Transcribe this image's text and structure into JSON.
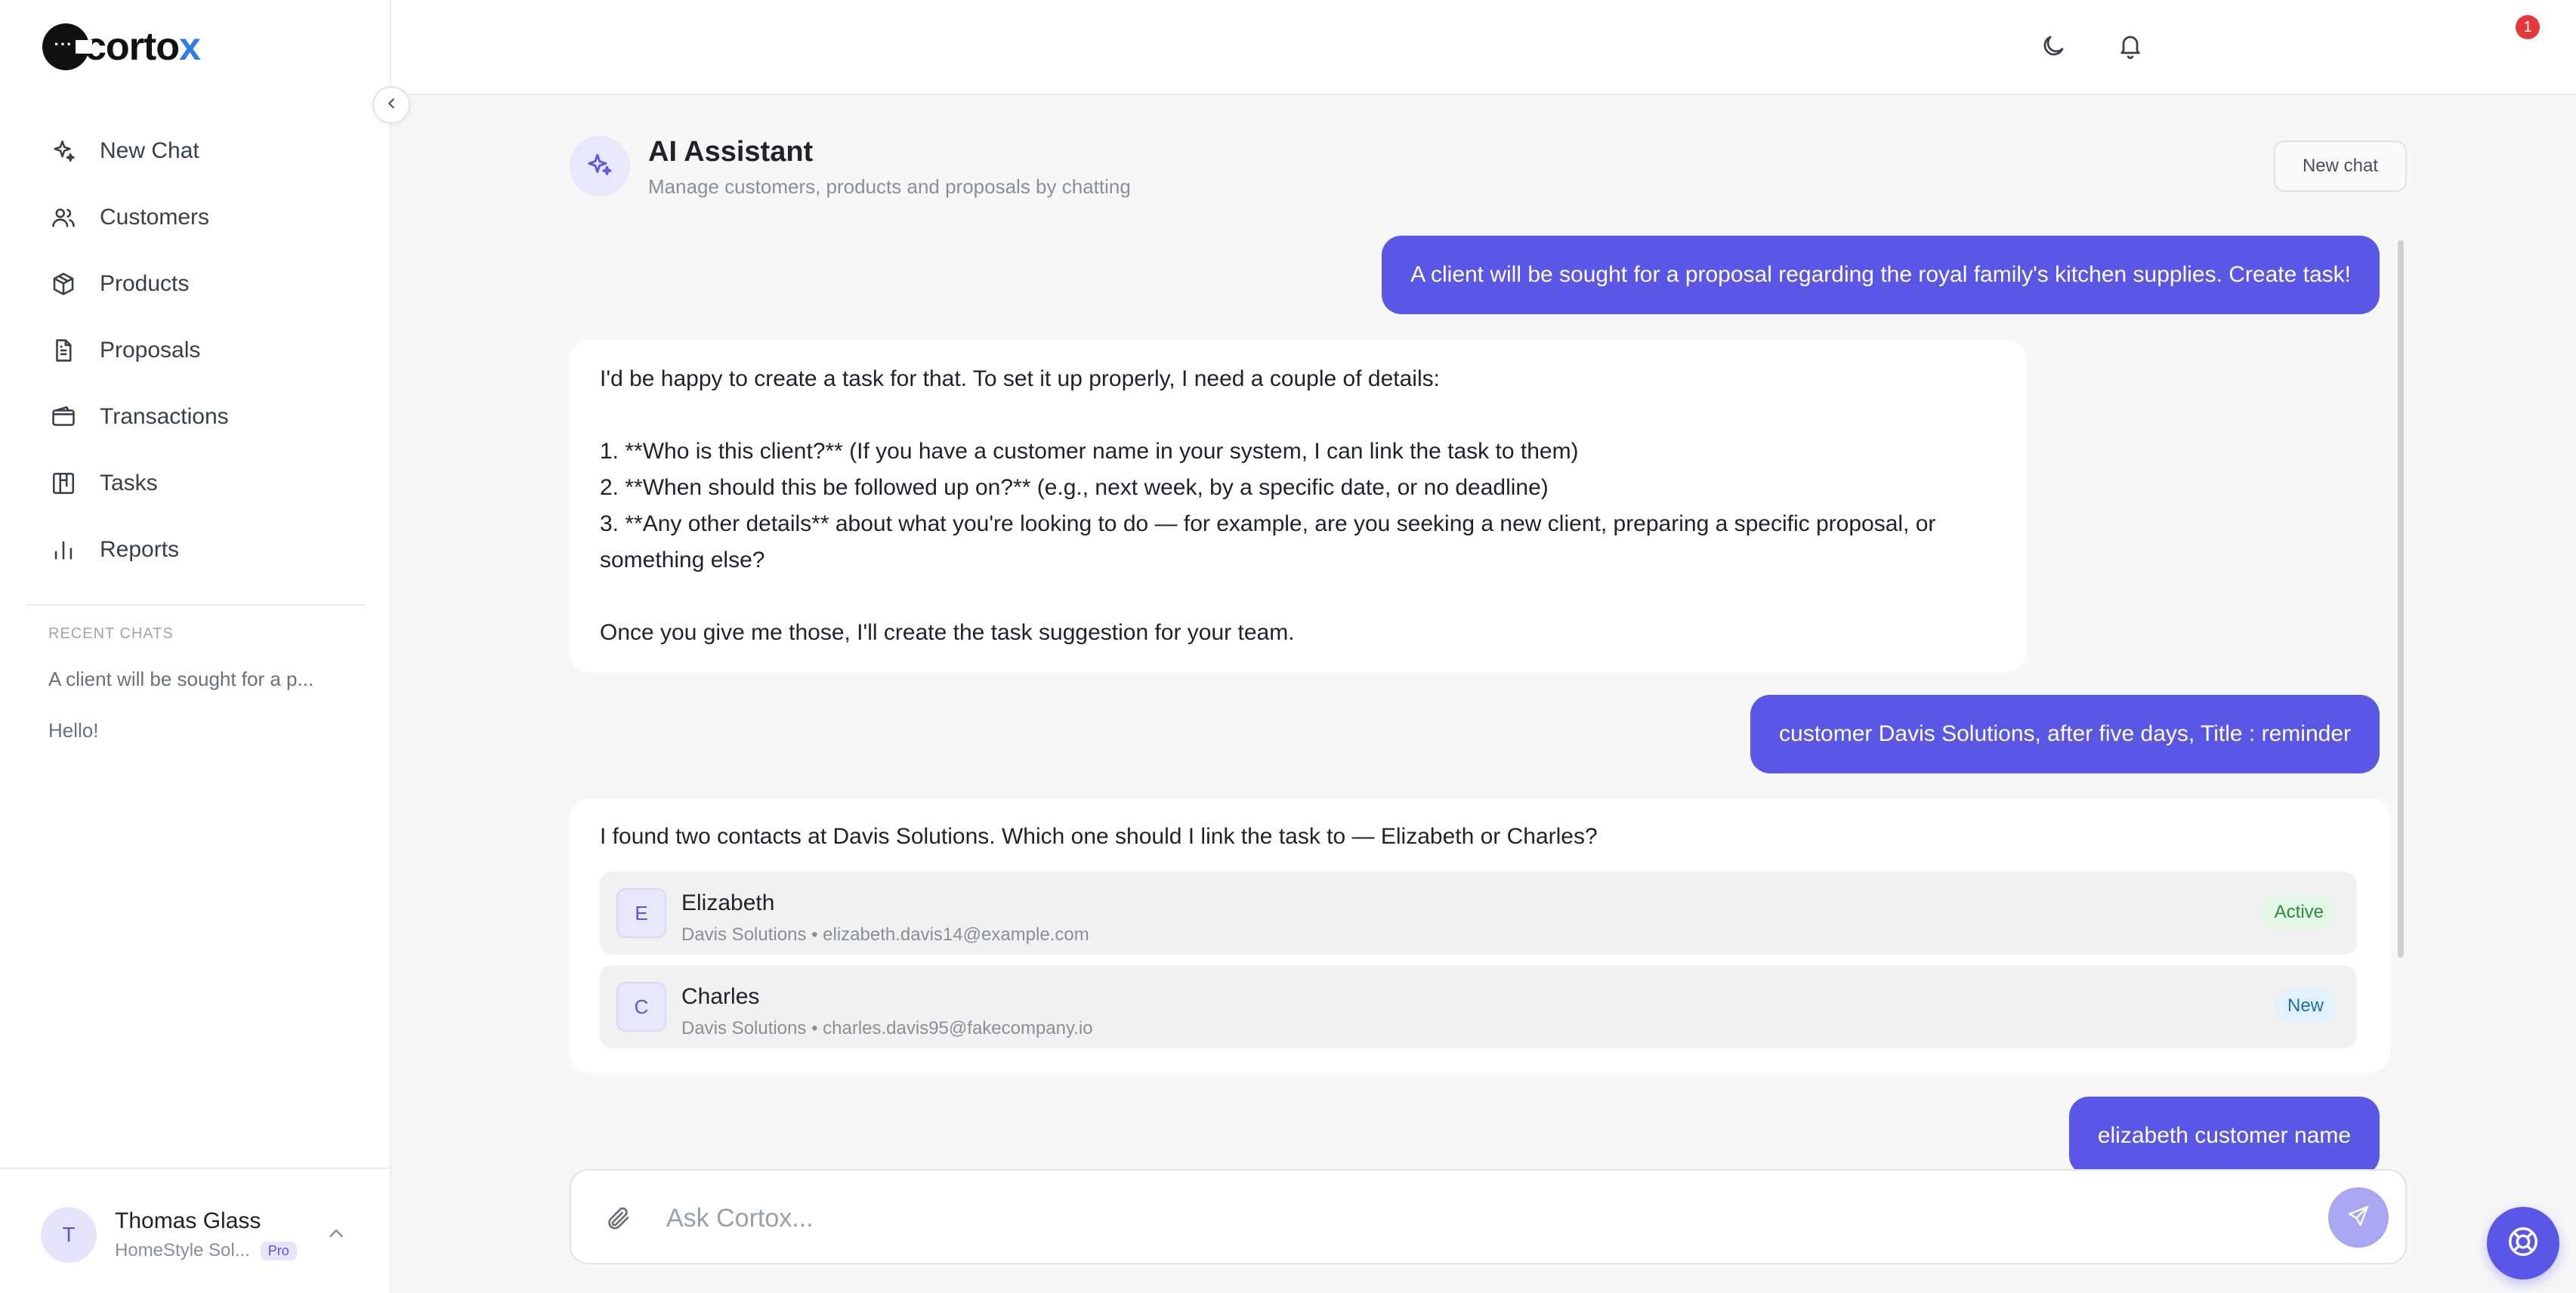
{
  "brand": {
    "name_main": "cortox",
    "logo_prefix": "cort",
    "logo_suffix": "x",
    "logo_o": "o"
  },
  "sidebar": {
    "items": [
      {
        "label": "New Chat",
        "icon": "sparkle-icon"
      },
      {
        "label": "Customers",
        "icon": "users-icon"
      },
      {
        "label": "Products",
        "icon": "box-icon"
      },
      {
        "label": "Proposals",
        "icon": "document-icon"
      },
      {
        "label": "Transactions",
        "icon": "wallet-icon"
      },
      {
        "label": "Tasks",
        "icon": "board-icon"
      },
      {
        "label": "Reports",
        "icon": "bar-chart-icon"
      }
    ],
    "recent_label": "RECENT CHATS",
    "recent": [
      "A client will be sought for a p...",
      "Hello!"
    ]
  },
  "user": {
    "initial": "T",
    "name": "Thomas Glass",
    "org": "HomeStyle Sol...",
    "plan": "Pro"
  },
  "topbar": {
    "notification_count": "1"
  },
  "header": {
    "title": "AI Assistant",
    "subtitle": "Manage customers, products and proposals by chatting",
    "new_chat": "New chat"
  },
  "messages": {
    "user1": "A client will be sought for a proposal regarding the royal family's kitchen supplies. Create task!",
    "bot1": {
      "line1": "I'd be happy to create a task for that. To set it up properly, I need a couple of details:",
      "line2": "1. **Who is this client?** (If you have a customer name in your system, I can link the task to them)",
      "line3": "2. **When should this be followed up on?** (e.g., next week, by a specific date, or no deadline)",
      "line4": "3. **Any other details** about what you're looking to do — for example, are you seeking a new client, preparing a specific proposal, or",
      "line5": "something else?",
      "line6": "Once you give me those, I'll create the task suggestion for your team."
    },
    "user2": "customer Davis Solutions, after five days, Title : reminder",
    "bot2": {
      "text": "I found two contacts at Davis Solutions. Which one should I link the task to — Elizabeth or Charles?",
      "contacts": [
        {
          "initial": "E",
          "name": "Elizabeth",
          "meta": "Davis Solutions • elizabeth.davis14@example.com",
          "status": "Active"
        },
        {
          "initial": "C",
          "name": "Charles",
          "meta": "Davis Solutions • charles.davis95@fakecompany.io",
          "status": "New"
        }
      ]
    },
    "user3": "elizabeth customer name"
  },
  "composer": {
    "placeholder": "Ask Cortox..."
  }
}
